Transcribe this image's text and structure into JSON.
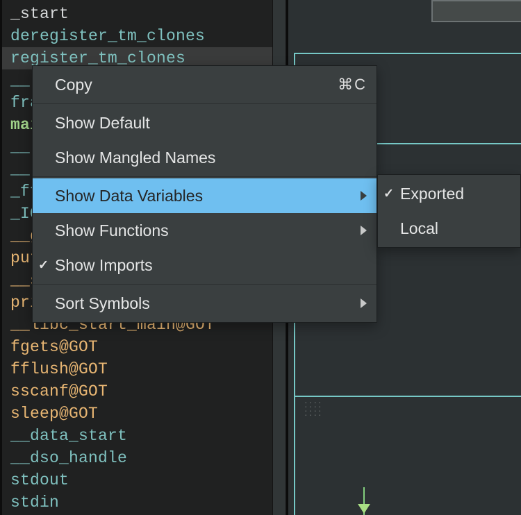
{
  "symbols": [
    {
      "text": "_start",
      "cls": "c-start",
      "sel": false
    },
    {
      "text": "deregister_tm_clones",
      "cls": "c-blue",
      "sel": false
    },
    {
      "text": "register_tm_clones",
      "cls": "c-blue",
      "sel": true
    },
    {
      "text": "__",
      "cls": "c-blue",
      "sel": false
    },
    {
      "text": "fra",
      "cls": "c-blue",
      "sel": false
    },
    {
      "text": "mai",
      "cls": "c-green",
      "sel": false
    },
    {
      "text": "__l",
      "cls": "c-blue",
      "sel": false
    },
    {
      "text": "__l",
      "cls": "c-blue",
      "sel": false
    },
    {
      "text": "_ff",
      "cls": "c-blue",
      "sel": false
    },
    {
      "text": " _IO",
      "cls": "c-blue",
      "sel": false
    },
    {
      "text": "__g",
      "cls": "c-got",
      "sel": false
    },
    {
      "text": "put",
      "cls": "c-got",
      "sel": false
    },
    {
      "text": "__s",
      "cls": "c-got",
      "sel": false
    },
    {
      "text": "pri",
      "cls": "c-got",
      "sel": false
    },
    {
      "text": "__libc_start_main@GOT",
      "cls": "c-got",
      "sel": false
    },
    {
      "text": "fgets@GOT",
      "cls": "c-got",
      "sel": false
    },
    {
      "text": "fflush@GOT",
      "cls": "c-got",
      "sel": false
    },
    {
      "text": "sscanf@GOT",
      "cls": "c-got",
      "sel": false
    },
    {
      "text": "sleep@GOT",
      "cls": "c-got",
      "sel": false
    },
    {
      "text": "__data_start",
      "cls": "c-blue",
      "sel": false
    },
    {
      "text": "__dso_handle",
      "cls": "c-blue",
      "sel": false
    },
    {
      "text": "stdout",
      "cls": "c-blue",
      "sel": false
    },
    {
      "text": "stdin",
      "cls": "c-blue",
      "sel": false
    }
  ],
  "menu": {
    "copy": {
      "label": "Copy",
      "shortcut": "⌘C"
    },
    "show_default": {
      "label": "Show Default"
    },
    "show_mangled": {
      "label": "Show Mangled Names"
    },
    "show_datavars": {
      "label": "Show Data Variables"
    },
    "show_funcs": {
      "label": "Show Functions"
    },
    "show_imports": {
      "label": "Show Imports"
    },
    "sort_symbols": {
      "label": "Sort Symbols"
    }
  },
  "submenu": {
    "exported": {
      "label": "Exported"
    },
    "local": {
      "label": "Local"
    }
  }
}
